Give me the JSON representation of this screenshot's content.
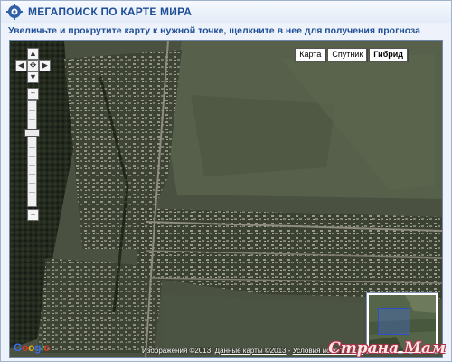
{
  "header": {
    "title": "МЕГАПОИСК ПО КАРТЕ МИРА",
    "logo_icon": "gear-icon",
    "subtitle": "Увеличьте и прокрутите карту к нужной точке, щелкните в нее для получения прогноза"
  },
  "map": {
    "type_buttons": [
      {
        "label": "Карта",
        "active": false
      },
      {
        "label": "Спутник",
        "active": false
      },
      {
        "label": "Гибрид",
        "active": true
      }
    ],
    "controls": {
      "pan_up_icon": "arrow-up-icon",
      "pan_left_icon": "arrow-left-icon",
      "pan_right_icon": "arrow-right-icon",
      "pan_down_icon": "arrow-down-icon",
      "center_icon": "center-icon",
      "zoom_in_icon": "plus-icon",
      "zoom_out_icon": "minus-icon",
      "zoom_in_symbol": "+",
      "zoom_out_symbol": "−"
    },
    "google_logo": "Google",
    "copyright": {
      "images": "Изображения ©2013",
      "separator1": ", ",
      "map_data": "Данные карты ©2013",
      "separator2": " - ",
      "terms": "Условия использования"
    }
  },
  "watermark": "Страна Мам",
  "colors": {
    "title_blue": "#1f4f96",
    "border": "#9fb3cf",
    "watermark_outline": "#b03045"
  }
}
